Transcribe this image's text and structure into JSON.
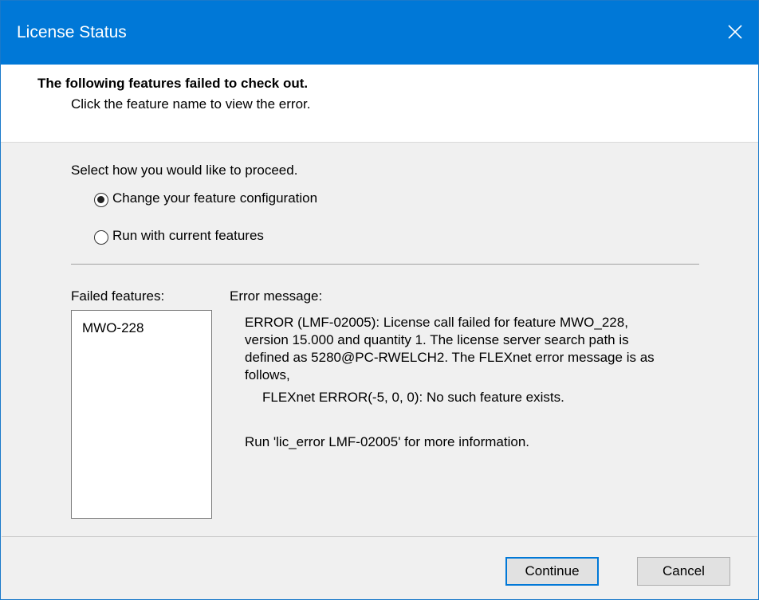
{
  "window": {
    "title": "License Status"
  },
  "header": {
    "title": "The following features failed to check out.",
    "subtitle": "Click the feature name to view the error."
  },
  "proceed": {
    "prompt": "Select how you would like to proceed.",
    "options": [
      {
        "label": "Change your feature configuration",
        "selected": true
      },
      {
        "label": "Run with current features",
        "selected": false
      }
    ]
  },
  "failed_features": {
    "label": "Failed features:",
    "items": [
      "MWO-228"
    ]
  },
  "error": {
    "label": "Error message:",
    "lines": [
      "ERROR (LMF-02005): License call failed for feature MWO_228,",
      "version 15.000 and quantity 1. The license server search path is",
      "defined as 5280@PC-RWELCH2. The FLEXnet error message is as",
      "follows,",
      "FLEXnet ERROR(-5, 0, 0): No such feature exists.",
      "Run 'lic_error LMF-02005' for more information."
    ]
  },
  "buttons": {
    "continue": "Continue",
    "cancel": "Cancel"
  },
  "icons": {
    "close": "close-icon",
    "radio_checked": "radio-checked",
    "radio_unchecked": "radio-unchecked"
  },
  "colors": {
    "titlebar": "#0078d7",
    "default_button_border": "#0078d7"
  }
}
